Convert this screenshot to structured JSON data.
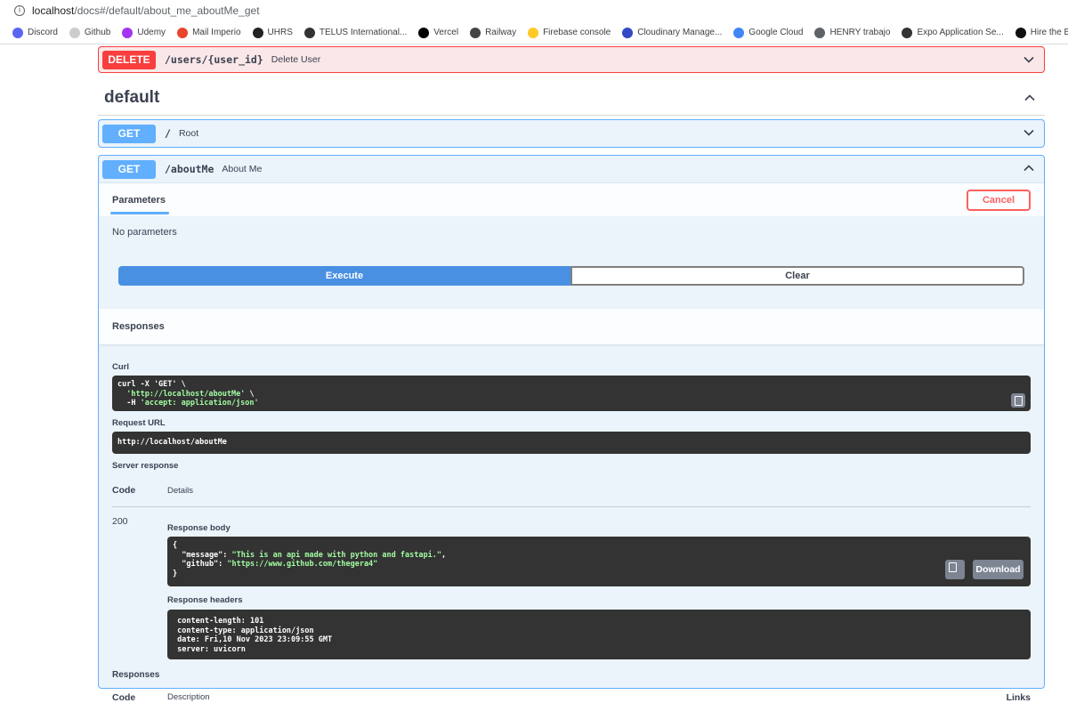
{
  "browser": {
    "url_host": "localhost",
    "url_path": "/docs#/default/about_me_aboutMe_get",
    "bookmarks": [
      {
        "label": "Discord",
        "icon": "discord-icon",
        "color": "#5865f2"
      },
      {
        "label": "Github",
        "icon": "github-icon",
        "color": "#cccccc"
      },
      {
        "label": "Udemy",
        "icon": "udemy-icon",
        "color": "#a435f0"
      },
      {
        "label": "Mail Imperio",
        "icon": "mail-icon",
        "color": "#e8452c"
      },
      {
        "label": "UHRS",
        "icon": "uhrs-icon",
        "color": "#222222"
      },
      {
        "label": "TELUS International...",
        "icon": "telus-icon",
        "color": "#333333"
      },
      {
        "label": "Vercel",
        "icon": "vercel-icon",
        "color": "#000000"
      },
      {
        "label": "Railway",
        "icon": "railway-icon",
        "color": "#444444"
      },
      {
        "label": "Firebase console",
        "icon": "firebase-icon",
        "color": "#ffca28"
      },
      {
        "label": "Cloudinary Manage...",
        "icon": "cloudinary-icon",
        "color": "#3448c5"
      },
      {
        "label": "Google Cloud",
        "icon": "api-icon",
        "color": "#4285f4"
      },
      {
        "label": "HENRY trabajo",
        "icon": "search-icon",
        "color": "#5f6368"
      },
      {
        "label": "Expo Application Se...",
        "icon": "expo-icon",
        "color": "#333333"
      },
      {
        "label": "Hire the Best LATA...",
        "icon": "hire-icon",
        "color": "#111111"
      }
    ]
  },
  "delete_op": {
    "method": "DELETE",
    "path": "/users/{user_id}",
    "summary": "Delete User"
  },
  "tag": {
    "name": "default"
  },
  "root_op": {
    "method": "GET",
    "path": "/",
    "summary": "Root"
  },
  "about_op": {
    "method": "GET",
    "path": "/aboutMe",
    "summary": "About Me",
    "parameters_tab": "Parameters",
    "cancel_label": "Cancel",
    "no_params": "No parameters",
    "execute_label": "Execute",
    "clear_label": "Clear",
    "responses_title": "Responses",
    "curl_label": "Curl",
    "curl_lines": [
      "curl -X 'GET' \\",
      "  'http://localhost/aboutMe' \\",
      "  -H 'accept: application/json'"
    ],
    "request_url_label": "Request URL",
    "request_url": "http://localhost/aboutMe",
    "server_response_label": "Server response",
    "code_header": "Code",
    "details_header": "Details",
    "response_code": "200",
    "response_body_label": "Response body",
    "response_body": [
      "{",
      "  \"message\": \"This is an api made with python and fastapi.\",",
      "  \"github\": \"https://www.github.com/thegera4\"",
      "}"
    ],
    "download_label": "Download",
    "response_headers_label": "Response headers",
    "response_headers": [
      " content-length: 101 ",
      " content-type: application/json ",
      " date: Fri,10 Nov 2023 23:09:55 GMT ",
      " server: uvicorn "
    ],
    "responses_label2": "Responses",
    "code_header2": "Code",
    "description_header": "Description",
    "links_header": "Links"
  },
  "colors": {
    "get": "#61affe",
    "delete": "#f93e3e",
    "execute": "#4990e2"
  }
}
